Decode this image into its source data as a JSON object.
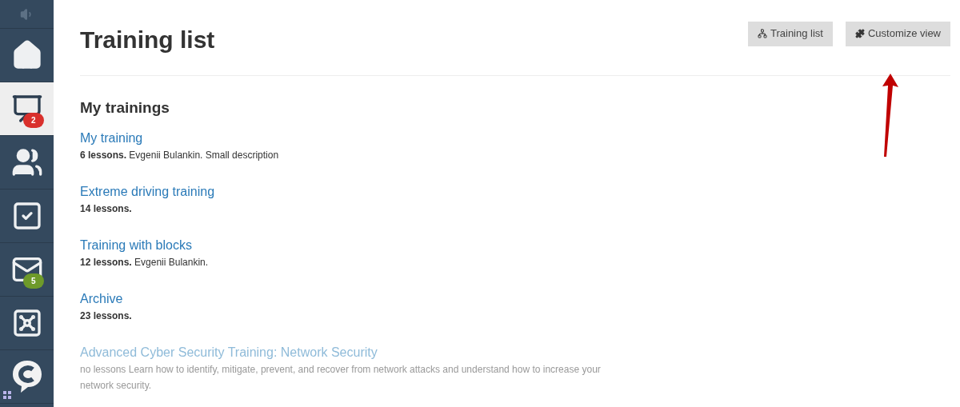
{
  "sidebar": {
    "items": [
      {
        "kind": "home",
        "selected": false
      },
      {
        "kind": "chart",
        "selected": true,
        "badge": "2",
        "color": "#d9302c"
      },
      {
        "kind": "users",
        "selected": false
      },
      {
        "kind": "tasks",
        "selected": false
      },
      {
        "kind": "mail",
        "selected": false,
        "badge": "5",
        "color": "#6e9a2a"
      },
      {
        "kind": "safe",
        "selected": false
      },
      {
        "kind": "chat",
        "selected": false
      }
    ]
  },
  "header": {
    "title": "Training list",
    "buttons": [
      {
        "kind": "list",
        "label": "Training list"
      },
      {
        "kind": "customize",
        "label": "Customize view"
      }
    ]
  },
  "section": {
    "title": "My trainings",
    "trainings": [
      {
        "title": "My training",
        "meta": "**6 lessons.** Evgenii Bulankin. Small description",
        "disabled": false
      },
      {
        "title": "Extreme driving training",
        "meta": "**14 lessons.**",
        "disabled": false
      },
      {
        "title": "Training with blocks",
        "meta": "**12 lessons.** Evgenii Bulankin.",
        "disabled": false
      },
      {
        "title": "Archive",
        "meta": "**23 lessons.**",
        "disabled": false
      },
      {
        "title": "Advanced Cyber Security Training: Network Security",
        "meta": "no lessons Learn how to identify, mitigate, prevent, and recover from network attacks and understand how to increase your network security.",
        "disabled": true
      }
    ]
  }
}
